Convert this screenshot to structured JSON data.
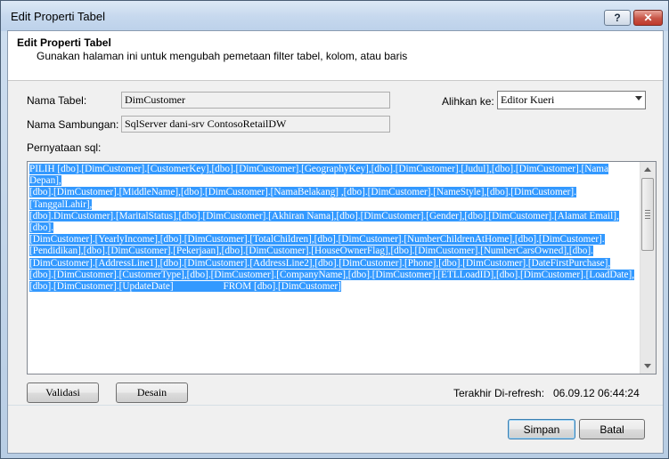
{
  "window": {
    "title": "Edit Properti Tabel",
    "help_label": "?",
    "close_label": "✕"
  },
  "header": {
    "title": "Edit Properti Tabel",
    "subtitle": "Gunakan halaman ini untuk mengubah pemetaan filter tabel, kolom, atau baris"
  },
  "form": {
    "table_name_label": "Nama Tabel:",
    "table_name_value": "DimCustomer",
    "connection_label": "Nama Sambungan:",
    "connection_value": "SqlServer dani-srv ContosoRetailDW",
    "switch_label": "Alihkan ke:",
    "switch_value": "Editor Kueri",
    "sql_label": "Pernyataan sql:"
  },
  "sql": {
    "lines": [
      "PILIH [dbo].[DimCustomer].[CustomerKey],[dbo].[DimCustomer].[GeographyKey],[dbo].[DimCustomer].[Judul],[dbo].[DimCustomer].[Nama Depan],",
      "[dbo].[DimCustomer].[MiddleName],[dbo].[DimCustomer].[NamaBelakang] ,[dbo].[DimCustomer].[NameStyle],[dbo].[DimCustomer].[TanggalLahir],",
      "[dbo].DimCustomer].[MaritalStatus],[dbo].[DimCustomer].[Akhiran Nama],[dbo].[DimCustomer].[Gender],[dbo].[DimCustomer].[Alamat Email],[dbo].",
      "[DimCustomer].[YearlyIncome],[dbo].[DimCustomer].[TotalChildren],[dbo].[DimCustomer].[NumberChildrenAtHome],[dbo].[DimCustomer].",
      "[Pendidikan],[dbo].[DimCustomer].[Pekerjaan],[dbo].[DimCustomer].[HouseOwnerFlag],[dbo].[DimCustomer].[NumberCarsOwned],[dbo].",
      "[DimCustomer].[AddressLine1],[dbo].[DimCustomer].[AddressLine2],[dbo].[DimCustomer].[Phone],[dbo].[DimCustomer].[DateFirstPurchase],",
      "[dbo].[DimCustomer].[CustomerType],[dbo].[DimCustomer].[CompanyName],[dbo].[DimCustomer].[ETLLoadID],[dbo].[DimCustomer].[LoadDate],",
      "[dbo].[DimCustomer].[UpdateDate]                    FROM [dbo].[DimCustomer]"
    ]
  },
  "actions": {
    "validate_label": "Validasi",
    "design_label": "Desain",
    "last_refresh_label": "Terakhir Di-refresh:",
    "last_refresh_value": "06.09.12 06:44:24",
    "save_label": "Simpan",
    "cancel_label": "Batal"
  }
}
